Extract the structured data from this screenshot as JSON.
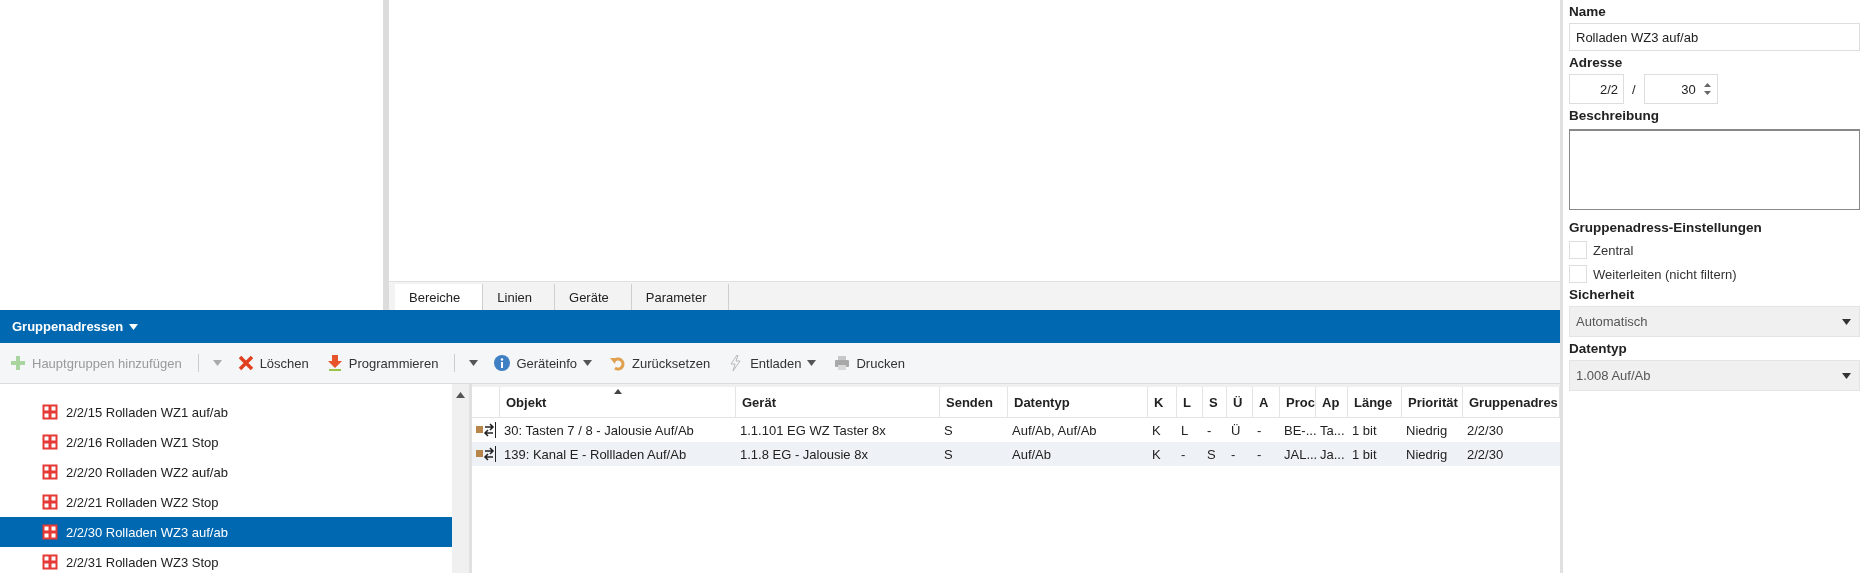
{
  "tabs": [
    {
      "label": "Bereiche",
      "selected": true
    },
    {
      "label": "Linien",
      "selected": false
    },
    {
      "label": "Geräte",
      "selected": false
    },
    {
      "label": "Parameter",
      "selected": false
    }
  ],
  "panel_title": "Gruppenadressen",
  "toolbar": [
    {
      "label": "Hauptgruppen hinzufügen",
      "kind": "add",
      "disabled": true,
      "dropdown": true,
      "split": true
    },
    {
      "label": "Löschen",
      "kind": "delete",
      "disabled": false,
      "dropdown": false,
      "split": false
    },
    {
      "label": "Programmieren",
      "kind": "program",
      "disabled": false,
      "dropdown": true,
      "split": true
    },
    {
      "label": "Geräteinfo",
      "kind": "info",
      "disabled": false,
      "dropdown": true,
      "split": false
    },
    {
      "label": "Zurücksetzen",
      "kind": "reset",
      "disabled": false,
      "dropdown": false,
      "split": false
    },
    {
      "label": "Entladen",
      "kind": "unload",
      "disabled": false,
      "dropdown": true,
      "split": false
    },
    {
      "label": "Drucken",
      "kind": "print",
      "disabled": false,
      "dropdown": false,
      "split": false
    }
  ],
  "tree": {
    "items": [
      {
        "label": "2/2/15 Rolladen WZ1 auf/ab",
        "selected": false
      },
      {
        "label": "2/2/16 Rolladen WZ1 Stop",
        "selected": false
      },
      {
        "label": "2/2/20 Rolladen WZ2 auf/ab",
        "selected": false
      },
      {
        "label": "2/2/21 Rolladen WZ2 Stop",
        "selected": false
      },
      {
        "label": "2/2/30 Rolladen WZ3 auf/ab",
        "selected": true
      },
      {
        "label": "2/2/31 Rolladen WZ3 Stop",
        "selected": false
      }
    ]
  },
  "table": {
    "columns": [
      {
        "label": "Objekt",
        "sorted": true
      },
      {
        "label": "Gerät",
        "sorted": false
      },
      {
        "label": "Senden",
        "sorted": false
      },
      {
        "label": "Datentyp",
        "sorted": false
      },
      {
        "label": "K",
        "sorted": false
      },
      {
        "label": "L",
        "sorted": false
      },
      {
        "label": "S",
        "sorted": false
      },
      {
        "label": "Ü",
        "sorted": false
      },
      {
        "label": "A",
        "sorted": false
      },
      {
        "label": "Proc",
        "sorted": false
      },
      {
        "label": "Ap",
        "sorted": false
      },
      {
        "label": "Länge",
        "sorted": false
      },
      {
        "label": "Priorität",
        "sorted": false
      },
      {
        "label": "Gruppenadres",
        "sorted": false
      }
    ],
    "rows": [
      {
        "cells": [
          "30: Tasten 7 / 8 - Jalousie Auf/Ab",
          "1.1.101 EG WZ Taster 8x",
          "S",
          "Auf/Ab, Auf/Ab",
          "K",
          "L",
          "-",
          "Ü",
          "-",
          "BE-...",
          "Ta...",
          "1 bit",
          "Niedrig",
          "2/2/30"
        ]
      },
      {
        "cells": [
          "139: Kanal E - Rollladen Auf/Ab",
          "1.1.8 EG - Jalousie 8x",
          "S",
          "Auf/Ab",
          "K",
          "-",
          "S",
          "-",
          "-",
          "JAL...",
          "Ja...",
          "1 bit",
          "Niedrig",
          "2/2/30"
        ]
      }
    ]
  },
  "properties": {
    "name_label": "Name",
    "name_value": "Rolladen WZ3 auf/ab",
    "address_label": "Adresse",
    "address_main": "2/2",
    "address_separator": "/",
    "address_sub": "30",
    "description_label": "Beschreibung",
    "settings_label": "Gruppenadress-Einstellungen",
    "checkboxes": [
      {
        "label": "Zentral",
        "checked": false
      },
      {
        "label": "Weiterleiten (nicht filtern)",
        "checked": false
      }
    ],
    "security_label": "Sicherheit",
    "security_value": "Automatisch",
    "datatype_label": "Datentyp",
    "datatype_value": "1.008 Auf/Ab"
  }
}
